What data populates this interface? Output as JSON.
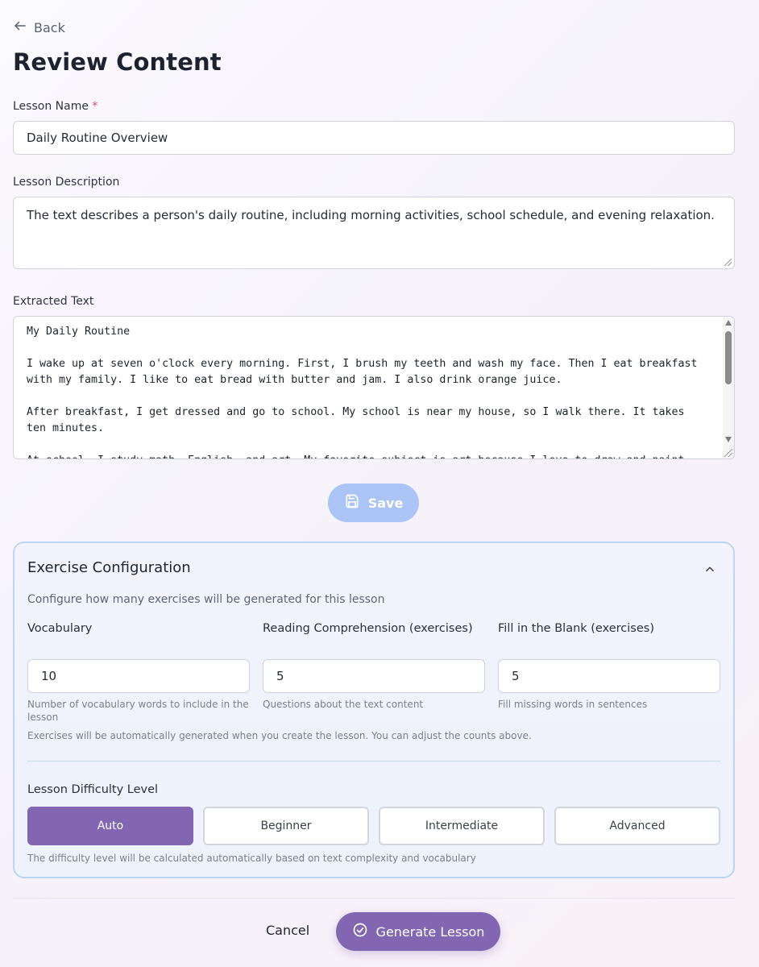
{
  "nav": {
    "back_label": "Back"
  },
  "page": {
    "title": "Review Content"
  },
  "form": {
    "lesson_name_label": "Lesson Name",
    "required_mark": "*",
    "lesson_name_value": "Daily Routine Overview",
    "lesson_description_label": "Lesson Description",
    "lesson_description_value": "The text describes a person's daily routine, including morning activities, school schedule, and evening relaxation.",
    "extracted_text_label": "Extracted Text",
    "extracted_text_value": "My Daily Routine\n\nI wake up at seven o'clock every morning. First, I brush my teeth and wash my face. Then I eat breakfast with my family. I like to eat bread with butter and jam. I also drink orange juice.\n\nAfter breakfast, I get dressed and go to school. My school is near my house, so I walk there. It takes ten minutes.\n\nAt school, I study math, English, and art. My favorite subject is art because I love to draw and paint. During"
  },
  "save_button": {
    "label": "Save",
    "state": "disabled"
  },
  "exercise_config": {
    "title": "Exercise Configuration",
    "expanded": true,
    "subtitle": "Configure how many exercises will be generated for this lesson",
    "fields": [
      {
        "label": "Vocabulary",
        "value": "10",
        "hint": "Number of vocabulary words to include in the lesson"
      },
      {
        "label": "Reading Comprehension (exercises)",
        "value": "5",
        "hint": "Questions about the text content"
      },
      {
        "label": "Fill in the Blank (exercises)",
        "value": "5",
        "hint": "Fill missing words in sentences"
      }
    ],
    "auto_note": "Exercises will be automatically generated when you create the lesson. You can adjust the counts above.",
    "difficulty": {
      "label": "Lesson Difficulty Level",
      "options": [
        "Auto",
        "Beginner",
        "Intermediate",
        "Advanced"
      ],
      "selected": "Auto",
      "note": "The difficulty level will be calculated automatically based on text complexity and vocabulary"
    }
  },
  "footer": {
    "cancel_label": "Cancel",
    "generate_label": "Generate Lesson"
  },
  "colors": {
    "accent": "#8266b1",
    "save_disabled": "#a9c4f5",
    "panel_border": "#b9d6f4",
    "required": "#e04a5a"
  },
  "icons": {
    "back": "arrow-left-icon",
    "save": "floppy-disk-icon",
    "collapse": "chevron-up-icon",
    "generate": "check-circle-icon"
  }
}
